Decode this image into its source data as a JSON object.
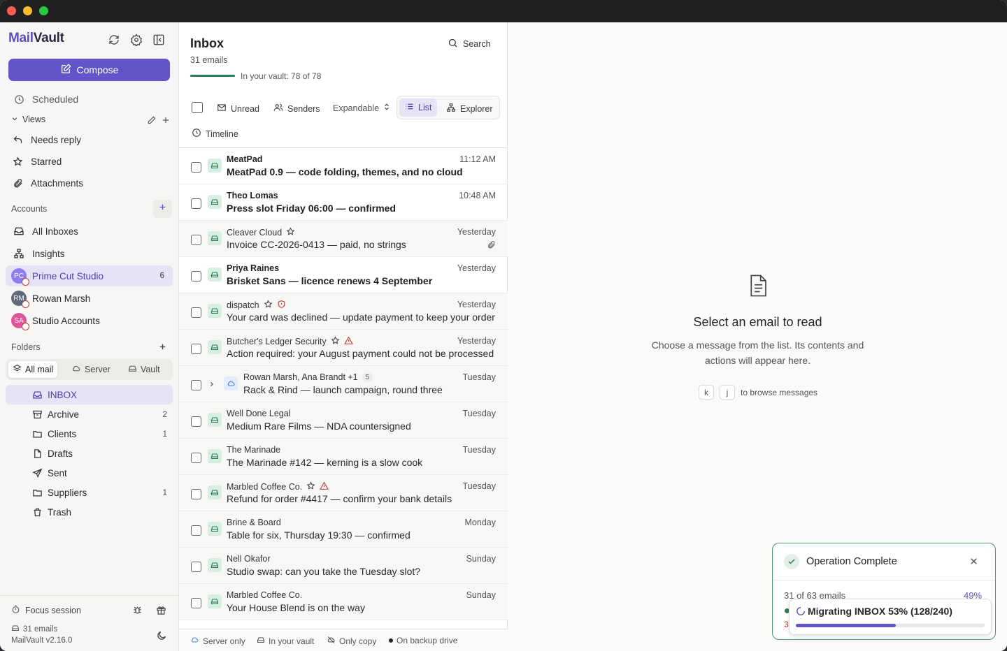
{
  "app": {
    "name_part1": "Mail",
    "name_part2": "Vault"
  },
  "colors": {
    "accent": "#6255c9",
    "selected_bg": "#e6e3f6",
    "vault_green": "#d9eee2",
    "success": "#4a9a6e"
  },
  "sidebar": {
    "compose_label": "Compose",
    "scheduled": "Scheduled",
    "views_header": "Views",
    "views": [
      "Needs reply",
      "Starred",
      "Attachments"
    ],
    "accounts_header": "Accounts",
    "all_inboxes": "All Inboxes",
    "insights": "Insights",
    "accounts": [
      {
        "initials": "PC",
        "name": "Prime Cut Studio",
        "count": "6",
        "color": "#8e7cf0"
      },
      {
        "initials": "RM",
        "name": "Rowan Marsh",
        "count": "",
        "color": "#5f6b7a"
      },
      {
        "initials": "SA",
        "name": "Studio Accounts",
        "count": "",
        "color": "#e0559a"
      }
    ],
    "folders_header": "Folders",
    "folder_filters": [
      "All mail",
      "Server",
      "Vault"
    ],
    "folders": [
      {
        "name": "INBOX",
        "count": "",
        "icon": "inbox-icon"
      },
      {
        "name": "Archive",
        "count": "2",
        "icon": "archive-icon"
      },
      {
        "name": "Clients",
        "count": "1",
        "icon": "folder-icon"
      },
      {
        "name": "Drafts",
        "count": "",
        "icon": "file-icon"
      },
      {
        "name": "Sent",
        "count": "",
        "icon": "send-icon"
      },
      {
        "name": "Suppliers",
        "count": "1",
        "icon": "folder-icon"
      },
      {
        "name": "Trash",
        "count": "",
        "icon": "trash-icon"
      }
    ],
    "footer": {
      "focus": "Focus session",
      "emails": "31 emails",
      "version": "MailVault v2.16.0"
    }
  },
  "list": {
    "title": "Inbox",
    "count_label": "31 emails",
    "vault_progress_label": "In your vault: 78 of 78",
    "vault_progress": 1.0,
    "search_label": "Search",
    "toolbar": {
      "unread": "Unread",
      "senders": "Senders",
      "expandable": "Expandable",
      "list": "List",
      "explorer": "Explorer",
      "timeline": "Timeline"
    },
    "emails": [
      {
        "sender": "MeatPad",
        "subject": "MeatPad 0.9 — code folding, themes, and no cloud",
        "time": "11:12 AM",
        "unread": true,
        "star": false,
        "flag": "",
        "attach": false,
        "thread": false
      },
      {
        "sender": "Theo Lomas",
        "subject": "Press slot Friday 06:00 — confirmed",
        "time": "10:48 AM",
        "unread": true,
        "star": false,
        "flag": "",
        "attach": false,
        "thread": false
      },
      {
        "sender": "Cleaver Cloud",
        "subject": "Invoice CC-2026-0413 — paid, no strings",
        "time": "Yesterday",
        "unread": false,
        "star": true,
        "flag": "",
        "attach": true,
        "thread": false
      },
      {
        "sender": "Priya Raines",
        "subject": "Brisket Sans — licence renews 4 September",
        "time": "Yesterday",
        "unread": true,
        "star": false,
        "flag": "",
        "attach": false,
        "thread": false
      },
      {
        "sender": "dispatch",
        "subject": "Your card was declined — update payment to keep your order",
        "time": "Yesterday",
        "unread": false,
        "star": true,
        "flag": "shield",
        "attach": false,
        "thread": false
      },
      {
        "sender": "Butcher's Ledger Security",
        "subject": "Action required: your August payment could not be processed",
        "time": "Yesterday",
        "unread": false,
        "star": true,
        "flag": "warning",
        "attach": false,
        "thread": false
      },
      {
        "sender": "Rowan Marsh, Ana Brandt +1",
        "subject": "Rack & Rind — launch campaign, round three",
        "time": "Tuesday",
        "unread": false,
        "star": false,
        "flag": "",
        "attach": false,
        "thread": true,
        "thread_count": "5"
      },
      {
        "sender": "Well Done Legal",
        "subject": "Medium Rare Films — NDA countersigned",
        "time": "Tuesday",
        "unread": false,
        "star": false,
        "flag": "",
        "attach": false,
        "thread": false
      },
      {
        "sender": "The Marinade",
        "subject": "The Marinade #142 — kerning is a slow cook",
        "time": "Tuesday",
        "unread": false,
        "star": false,
        "flag": "",
        "attach": false,
        "thread": false
      },
      {
        "sender": "Marbled Coffee Co.",
        "subject": "Refund for order #4417 — confirm your bank details",
        "time": "Tuesday",
        "unread": false,
        "star": true,
        "flag": "warning",
        "attach": false,
        "thread": false
      },
      {
        "sender": "Brine & Board",
        "subject": "Table for six, Thursday 19:30 — confirmed",
        "time": "Monday",
        "unread": false,
        "star": false,
        "flag": "",
        "attach": false,
        "thread": false
      },
      {
        "sender": "Nell Okafor",
        "subject": "Studio swap: can you take the Tuesday slot?",
        "time": "Sunday",
        "unread": false,
        "star": false,
        "flag": "",
        "attach": false,
        "thread": false
      },
      {
        "sender": "Marbled Coffee Co.",
        "subject": "Your House Blend is on the way",
        "time": "Sunday",
        "unread": false,
        "star": false,
        "flag": "",
        "attach": false,
        "thread": false
      }
    ],
    "legend": [
      "Server only",
      "In your vault",
      "Only copy",
      "On backup drive"
    ]
  },
  "reader": {
    "empty_title": "Select an email to read",
    "empty_body_line1": "Choose a message from the list. Its contents and",
    "empty_body_line2": "actions will appear here.",
    "key1": "k",
    "key2": "j",
    "key_hint": "to browse messages"
  },
  "toast": {
    "title": "Operation Complete",
    "progress_text": "31 of 63 emails",
    "progress_pct": "49%",
    "row3": "3",
    "migration_label": "Migrating INBOX 53% (128/240)",
    "migration_progress": 0.53
  }
}
